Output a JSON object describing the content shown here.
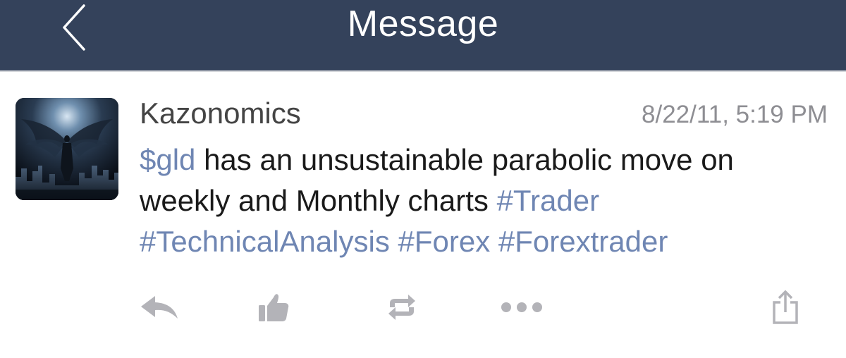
{
  "nav": {
    "title": "Message",
    "back_icon": "chevron-left-icon"
  },
  "message": {
    "avatar_icon": "winged-figure-avatar",
    "author": "Kazonomics",
    "timestamp": "8/22/11, 5:19 PM",
    "segments": [
      {
        "text": "$gld",
        "type": "tag"
      },
      {
        "text": " has an unsustainable parabolic move on weekly and Monthly charts ",
        "type": "text"
      },
      {
        "text": "#Trader",
        "type": "tag"
      },
      {
        "text": " ",
        "type": "text"
      },
      {
        "text": "#TechnicalAnalysis",
        "type": "tag"
      },
      {
        "text": " ",
        "type": "text"
      },
      {
        "text": "#Forex",
        "type": "tag"
      },
      {
        "text": " ",
        "type": "text"
      },
      {
        "text": "#Forextrader",
        "type": "tag"
      }
    ]
  },
  "actions": [
    {
      "name": "reply-button",
      "icon": "reply-icon"
    },
    {
      "name": "like-button",
      "icon": "thumbs-up-icon"
    },
    {
      "name": "repost-button",
      "icon": "repost-icon"
    },
    {
      "name": "more-button",
      "icon": "more-dots-icon"
    },
    {
      "name": "share-button",
      "icon": "share-icon"
    }
  ],
  "colors": {
    "nav_background": "#34425b",
    "tag_link": "#6f86b3",
    "icon_gray": "#b3b3b8",
    "timestamp_gray": "#8e8e93"
  }
}
